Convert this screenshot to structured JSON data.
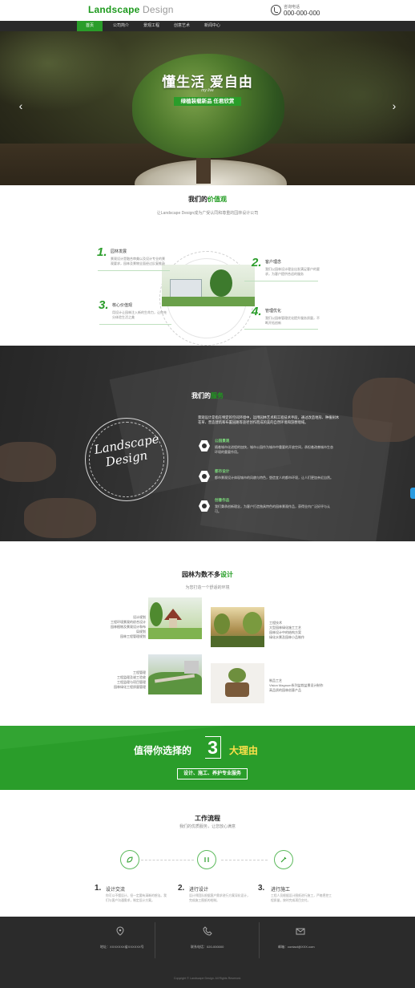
{
  "header": {
    "logo_part1": "Landscape",
    "logo_part2": "Design",
    "hotline_label": "咨询电话",
    "hotline_number": "000-000-000"
  },
  "nav": {
    "items": [
      "首页",
      "公司简介",
      "景观工程",
      "创意艺术",
      "新闻中心"
    ]
  },
  "banner": {
    "title": "懂生活 爱自由",
    "subtitle": "my live",
    "button": "绿植装载新品 任君欣赏",
    "prev": "‹",
    "next": "›"
  },
  "values": {
    "title_plain": "我们的",
    "title_green": "价值观",
    "subtitle": "让Landscape Design成为广受认同和尊重的园林设计公司",
    "items": [
      {
        "num": "1.",
        "title": "园林发展",
        "desc": "景观设计是融合审美以及设计专业的景观要求，园林及景物全面经过反复推敲"
      },
      {
        "num": "2.",
        "title": "客户理念",
        "desc": "我们以园林设计理念出发满足客户的要求，为客户提供合适的服务"
      },
      {
        "num": "3.",
        "title": "核心价值观",
        "desc": "用设计让园林注入新的生命力，让你充分体验生活之美"
      },
      {
        "num": "4.",
        "title": "管理优化",
        "desc": "我们以园林管理优化提升服务质量，不断开拓创新"
      }
    ]
  },
  "services": {
    "title_plain": "我们的",
    "title_green": "服务",
    "badge_line1": "Landscape",
    "badge_line2": "Design",
    "intro": "景观设计是指在特定的空间环境中，运用园林艺术和工程技术手段，通过改造地形、种植树木花草、营造建筑和布置园路等途径创作而成的美的自然环境和游憩境域。",
    "items": [
      {
        "title": "公园景观",
        "desc": "随着城市化进程的加快，城市公园作为城市中重要的开放空间，承担着改善城市生态环境的重要作用。"
      },
      {
        "title": "都市设计",
        "desc": "都市景观设计体现城市的风貌与特色，塑造宜人的都市环境，让人们更加亲近自然。"
      },
      {
        "title": "创意作品",
        "desc": "我们秉承创新理念，为客户打造独具特色的园林景观作品，获得业内广泛好评与认可。"
      }
    ]
  },
  "gallery": {
    "title_plain": "园林为数不多",
    "title_green": "设计",
    "subtitle": "为您打造一个舒适的环境",
    "items": [
      {
        "text": "设计规划\n工程环境景观的综合设计\n园林植物及景观设计和布局规划\n园林工程管理规划"
      },
      {
        "text": "工程技术\n大型园林绿化施工工艺\n园林设计中的结构方案\n绿化水景及园林小品制作"
      },
      {
        "text": "工程管理\n工程监理及竣工验收\n工程监理与项目管理\n园林绿化工程质量管理"
      },
      {
        "text": "制品工艺\nVision Magnum系列盆栽盆景设计制作\n高品质的园林创意产品"
      }
    ]
  },
  "reasons": {
    "title": "值得你选择的",
    "number": "3",
    "title_end": "大理由",
    "button": "设计、施工、养护专业服务"
  },
  "process": {
    "title": "工作流程",
    "subtitle": "我们的优质服务，让您放心满意",
    "steps": [
      {
        "num": "1.",
        "title": "设计交流",
        "desc": "你可以不懂设计，但一定要有清晰的想法。我们与客户沟通需求，制定设计方案。"
      },
      {
        "num": "2.",
        "title": "进行设计",
        "desc": "设计师团队根据客户需求进行方案深化设计，完成施工图纸的绘制。"
      },
      {
        "num": "3.",
        "title": "进行施工",
        "desc": "工程人员根据设计图纸进行施工，严格把控工程质量，按时完成项目交付。"
      }
    ]
  },
  "footer": {
    "address": "地址：XXXXXXX省XXXXXX号",
    "phone": "联系电话：020-000000",
    "email": "邮箱：contact@XXX.com",
    "copyright": "Copyright © Landscape Design. All Rights Reserved."
  },
  "colors": {
    "primary": "#2a9d2a",
    "dark": "#2a2a2a",
    "yellow": "#ffe14a"
  }
}
